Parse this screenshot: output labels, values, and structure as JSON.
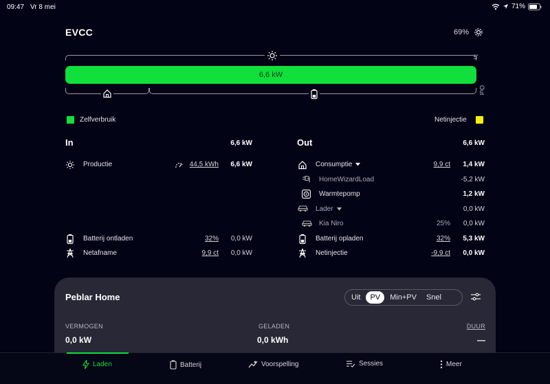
{
  "status_bar": {
    "time": "09:47",
    "date": "Vr 8 mei",
    "battery": "71%"
  },
  "header": {
    "title": "EVCC",
    "battery_soc": "69%"
  },
  "flow": {
    "bar_label": "6,6 kW",
    "in_label": "In",
    "out_label": "Out"
  },
  "legend": {
    "left": "Zelfverbruik",
    "right": "Netinjectie",
    "left_color": "#10df3c",
    "right_color": "#f5f10a"
  },
  "in_section": {
    "title": "In",
    "total": "6,6 kW",
    "rows": [
      {
        "label": "Productie",
        "link": "44,5 kWh",
        "value": "6,6 kW",
        "icon": "sun-icon"
      },
      {
        "label": "Batterij ontladen",
        "link": "32%",
        "value": "0,0 kW",
        "icon": "battery-icon"
      },
      {
        "label": "Netafname",
        "link": "9,9 ct",
        "value": "0,0 kW",
        "icon": "grid-tower-icon"
      }
    ]
  },
  "out_section": {
    "title": "Out",
    "total": "6,6 kW",
    "consumption": {
      "label": "Consumptie",
      "link": "9,9 ct",
      "value": "1,4 kW"
    },
    "hw": {
      "label": "HomeWizardLoad",
      "value": "-5,2 kW"
    },
    "heatpump": {
      "label": "Warmtepomp",
      "value": "1,2 kW"
    },
    "charger": {
      "label": "Lader",
      "value": "0,0 kW"
    },
    "car": {
      "label": "Kia Niro",
      "meta": "25%",
      "value": "0,0 kW"
    },
    "battery": {
      "label": "Batterij opladen",
      "link": "32%",
      "value": "5,3 kW"
    },
    "grid": {
      "label": "Netinjectie",
      "link": "-9,9 ct",
      "value": "0,0 kW"
    }
  },
  "loadpoint": {
    "title": "Peblar Home",
    "modes": [
      "Uit",
      "PV",
      "Min+PV",
      "Snel"
    ],
    "active_mode": "PV",
    "power_label": "VERMOGEN",
    "power_value": "0,0 kW",
    "charged_label": "GELADEN",
    "charged_value": "0,0 kWh",
    "duration_label": "DUUR",
    "duration_value": "—"
  },
  "nav": {
    "items": [
      {
        "label": "Laden",
        "icon": "bolt-icon",
        "active": true
      },
      {
        "label": "Batterij",
        "icon": "battery-icon"
      },
      {
        "label": "Voorspelling",
        "icon": "forecast-icon"
      },
      {
        "label": "Sessies",
        "icon": "list-check-icon"
      },
      {
        "label": "Meer",
        "icon": "more-icon"
      }
    ]
  }
}
